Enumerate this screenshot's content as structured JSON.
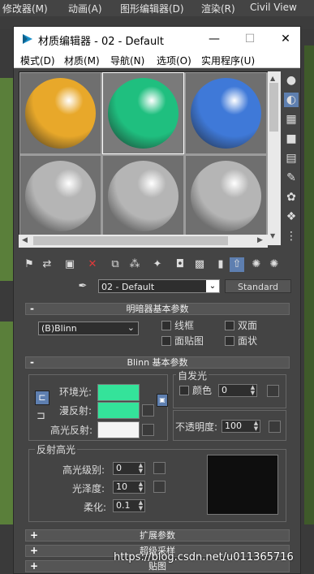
{
  "host": {
    "menus": [
      "修改器(M)",
      "动画(A)",
      "图形编辑器(D)",
      "渲染(R)",
      "Civil View"
    ]
  },
  "window": {
    "title": "材质编辑器 - 02 - Default",
    "minimize": "—",
    "maximize": "☐",
    "close": "✕"
  },
  "menubar": [
    "模式(D)",
    "材质(M)",
    "导航(N)",
    "选项(O)",
    "实用程序(U)"
  ],
  "samples": [
    {
      "color": "#e8a82a"
    },
    {
      "color": "#1fbf7f"
    },
    {
      "color": "#3f79d8"
    },
    {
      "color": "#b5b5b5"
    },
    {
      "color": "#b5b5b5"
    },
    {
      "color": "#b5b5b5"
    }
  ],
  "material": {
    "name": "02 - Default",
    "type": "Standard",
    "dropdown_arrow": "⌄"
  },
  "shader_rollout": {
    "sign": "-",
    "title": "明暗器基本参数",
    "shader": "(B)Blinn",
    "options": [
      "线框",
      "双面",
      "面贴图",
      "面状"
    ]
  },
  "blinn_rollout": {
    "sign": "-",
    "title": "Blinn 基本参数",
    "ambient_label": "环境光:",
    "diffuse_label": "漫反射:",
    "specular_label": "高光反射:",
    "ambient_color": "#34e39a",
    "diffuse_color": "#34e39a",
    "specular_color": "#f4f4f4",
    "self_illum": {
      "title": "自发光",
      "color_label": "颜色",
      "value": "0"
    },
    "opacity": {
      "label": "不透明度:",
      "value": "100"
    },
    "specular_highlights": {
      "title": "反射高光",
      "level_label": "高光级别:",
      "level_value": "0",
      "gloss_label": "光泽度:",
      "gloss_value": "10",
      "soften_label": "柔化:",
      "soften_value": "0.1"
    }
  },
  "collapsed_rollouts": [
    {
      "sign": "+",
      "title": "扩展参数"
    },
    {
      "sign": "+",
      "title": "超级采样"
    },
    {
      "sign": "+",
      "title": "贴图"
    }
  ],
  "watermark": "https://blog.csdn.net/u011365716"
}
